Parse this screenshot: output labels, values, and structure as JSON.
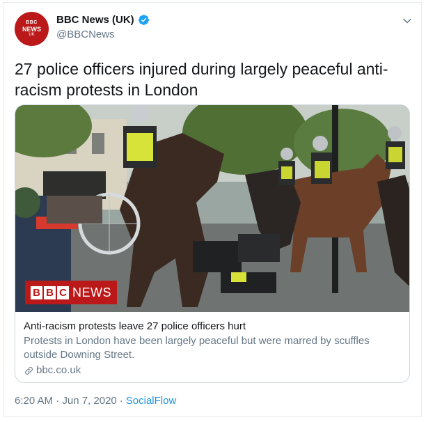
{
  "author": {
    "avatar_text": [
      "BBC",
      "NEWS",
      "UK"
    ],
    "display_name": "BBC News (UK)",
    "handle": "@BBCNews",
    "verified_icon": "verified-badge-icon",
    "verified_color": "#1da1f2"
  },
  "tweet": {
    "text": "27 police officers injured during largely peaceful anti-racism protests in London",
    "timestamp": "6:20 AM · Jun 7, 2020",
    "separator": "·",
    "source": "SocialFlow"
  },
  "card": {
    "image_badge": {
      "letters": [
        "B",
        "B",
        "C"
      ],
      "word": "NEWS"
    },
    "title": "Anti-racism protests leave 27 police officers hurt",
    "description": "Protests in London have been largely peaceful but were marred by scuffles outside Downing Street.",
    "domain": "bbc.co.uk",
    "link_icon": "link-icon"
  },
  "colors": {
    "brand_red": "#bb1919",
    "link_blue": "#1b95e0",
    "secondary_text": "#657786"
  }
}
